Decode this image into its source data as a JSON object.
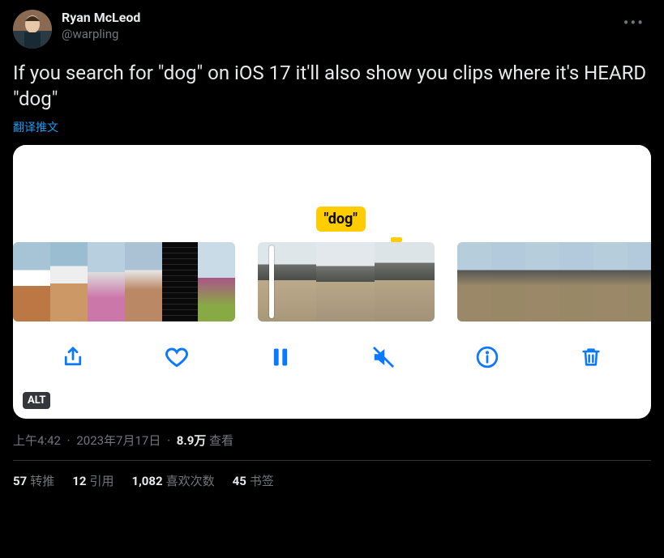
{
  "author": {
    "display_name": "Ryan McLeod",
    "handle": "@warpling"
  },
  "tweet_text": "If you search for \"dog\" on iOS 17 it'll also show you clips where it's HEARD \"dog\"",
  "translate_label": "翻译推文",
  "media": {
    "search_term_label": "\"dog\"",
    "alt_badge": "ALT"
  },
  "meta": {
    "time": "上午4:42",
    "date": "2023年7月17日",
    "views_count": "8.9万",
    "views_label": "查看"
  },
  "stats": {
    "retweets_count": "57",
    "retweets_label": "转推",
    "quotes_count": "12",
    "quotes_label": "引用",
    "likes_count": "1,082",
    "likes_label": "喜欢次数",
    "bookmarks_count": "45",
    "bookmarks_label": "书签"
  }
}
